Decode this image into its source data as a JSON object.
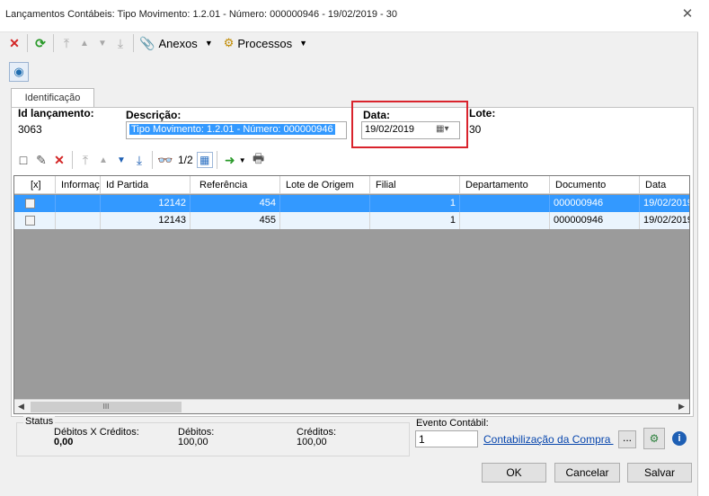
{
  "window": {
    "title": "Lançamentos Contábeis: Tipo Movimento: 1.2.01 - Número: 000000946 - 19/02/2019 - 30"
  },
  "toolbar": {
    "anexos_label": "Anexos",
    "processos_label": "Processos"
  },
  "tabs": [
    {
      "label": "Identificação"
    }
  ],
  "form": {
    "id_label": "Id lançamento:",
    "id_value": "3063",
    "descricao_label": "Descrição:",
    "descricao_value": "Tipo Movimento: 1.2.01 - Número: 000000946",
    "data_label": "Data:",
    "data_value": "19/02/2019",
    "lote_label": "Lote:",
    "lote_value": "30"
  },
  "grid_toolbar": {
    "page_indicator": "1/2"
  },
  "grid": {
    "columns": [
      "[x]",
      "Informaç",
      "Id Partida",
      "Referência",
      "Lote de Origem",
      "Filial",
      "Departamento",
      "Documento",
      "Data"
    ],
    "rows": [
      {
        "checked": false,
        "informacao": "",
        "id_partida": "12142",
        "referencia": "454",
        "lote_origem": "",
        "filial": "1",
        "departamento": "",
        "documento": "000000946",
        "data": "19/02/2019",
        "selected": true
      },
      {
        "checked": false,
        "informacao": "",
        "id_partida": "12143",
        "referencia": "455",
        "lote_origem": "",
        "filial": "1",
        "departamento": "",
        "documento": "000000946",
        "data": "19/02/2019",
        "selected": false
      }
    ],
    "hscroll_grip": "III"
  },
  "status": {
    "label": "Status",
    "debitos_creditos_label": "Débitos X Créditos:",
    "debitos_creditos_value": "0,00",
    "debitos_label": "Débitos:",
    "debitos_value": "100,00",
    "creditos_label": "Créditos:",
    "creditos_value": "100,00"
  },
  "evento": {
    "label": "Evento Contábil:",
    "code": "1",
    "link": "Contabilização da Compra p/ (",
    "lookup_label": "..."
  },
  "buttons": {
    "ok": "OK",
    "cancel": "Cancelar",
    "save": "Salvar"
  },
  "colors": {
    "selection": "#3399ff",
    "highlight_border": "#d9232c"
  }
}
